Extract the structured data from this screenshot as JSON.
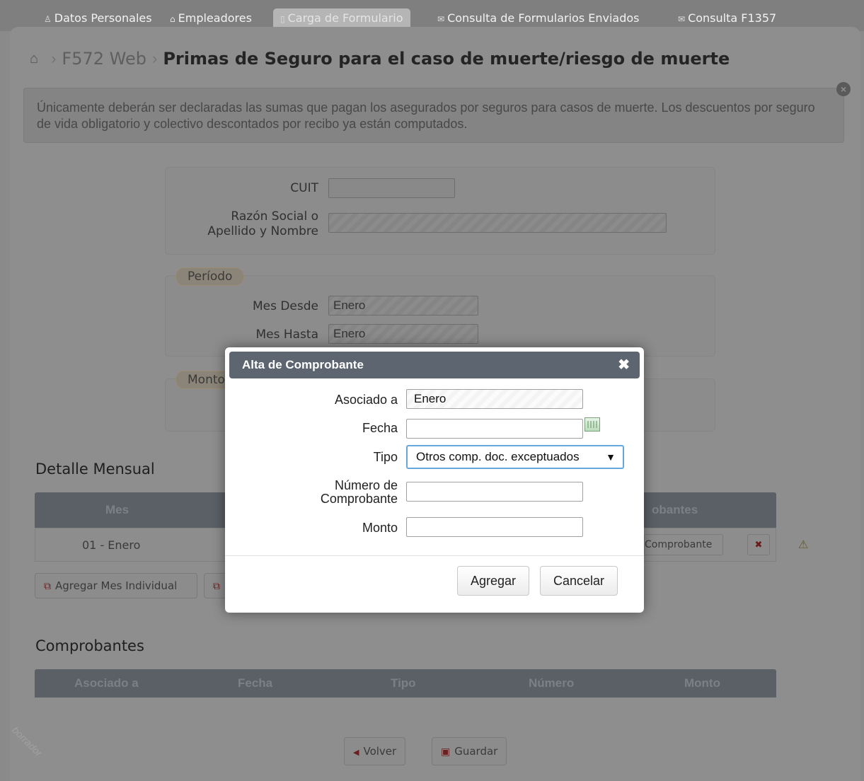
{
  "nav": {
    "tabs": [
      {
        "icon": "user-icon",
        "label": "Datos Personales"
      },
      {
        "icon": "building-icon",
        "label": "Empleadores"
      },
      {
        "icon": "document-icon",
        "label": "Carga de Formulario"
      },
      {
        "icon": "mail-icon",
        "label": "Consulta de Formularios Enviados"
      },
      {
        "icon": "mail-icon",
        "label": "Consulta F1357"
      }
    ]
  },
  "breadcrumb": {
    "parent": "F572 Web",
    "current": "Primas de Seguro para el caso de muerte/riesgo de muerte"
  },
  "info": {
    "text": "Únicamente deberán ser declaradas las sumas que pagan los asegurados por seguros para casos de muerte. Los descuentos por seguro de vida obligatorio y colectivo descontados por recibo ya están computados."
  },
  "form": {
    "cuit_label": "CUIT",
    "cuit_value": "",
    "razon_label_1": "Razón Social o",
    "razon_label_2": "Apellido y Nombre",
    "razon_value": "",
    "periodo_legend": "Período",
    "mes_desde_label": "Mes Desde",
    "mes_desde_value": "Enero",
    "mes_hasta_label": "Mes Hasta",
    "mes_hasta_value": "Enero",
    "monto_legend": "Monto"
  },
  "detalle": {
    "title": "Detalle Mensual",
    "col_mes": "Mes",
    "col_comprobantes": "obantes",
    "row_mes": "01 - Enero",
    "row_comprobante_btn": "Comprobante",
    "row_delete": "✖",
    "row_warning": "⚠",
    "add_individual": "Agregar Mes Individual"
  },
  "comprobantes": {
    "title": "Comprobantes",
    "columns": [
      "Asociado a",
      "Fecha",
      "Tipo",
      "Número",
      "Monto"
    ]
  },
  "footer": {
    "volver": "Volver",
    "guardar": "Guardar",
    "watermark": "borrador"
  },
  "modal": {
    "title": "Alta de Comprobante",
    "close": "✖",
    "asociado_label": "Asociado a",
    "asociado_value": "Enero",
    "fecha_label": "Fecha",
    "fecha_value": "",
    "tipo_label": "Tipo",
    "tipo_value": "Otros comp. doc. exceptuados",
    "numero_label_1": "Número de",
    "numero_label_2": "Comprobante",
    "numero_value": "",
    "monto_label": "Monto",
    "monto_value": "",
    "agregar": "Agregar",
    "cancelar": "Cancelar"
  }
}
